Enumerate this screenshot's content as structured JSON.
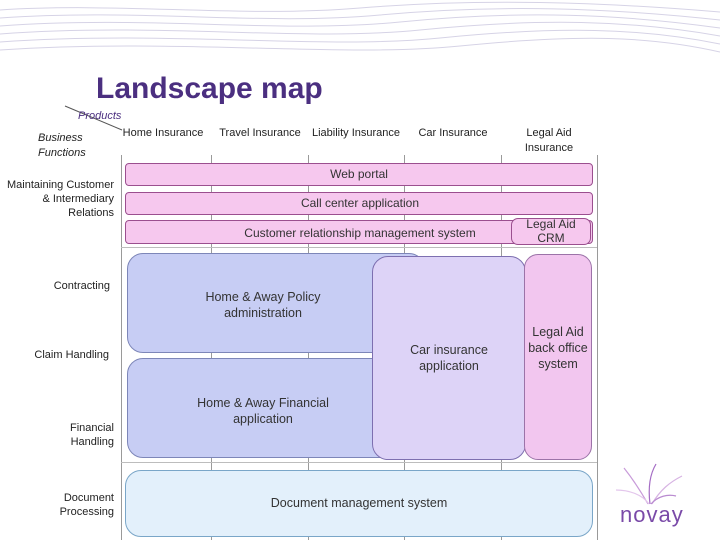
{
  "title": "Landscape map",
  "axes": {
    "products": "Products",
    "business_functions": "Business Functions"
  },
  "products": [
    "Home Insurance",
    "Travel Insurance",
    "Liability Insurance",
    "Car Insurance",
    "Legal Aid Insurance"
  ],
  "functions": [
    "Maintaining Customer & Intermediary Relations",
    "Contracting",
    "Claim Handling",
    "Financial Handling",
    "Document Processing"
  ],
  "systems": {
    "web_portal": "Web portal",
    "call_center": "Call center application",
    "crm": "Customer relationship management system",
    "legal_crm": "Legal Aid CRM",
    "policy_admin": "Home & Away Policy administration",
    "car_app": "Car insurance application",
    "financial_app": "Home & Away Financial application",
    "legal_backoffice": "Legal Aid back office system",
    "dms": "Document management system"
  },
  "logo": "novay",
  "colors": {
    "title": "#4b2f80",
    "pink": "#f6c8ee",
    "blue": "#c7cdf4",
    "lavender": "#ddd3f7",
    "light_blue": "#e3f0fb",
    "logo": "#7a4aa8"
  }
}
